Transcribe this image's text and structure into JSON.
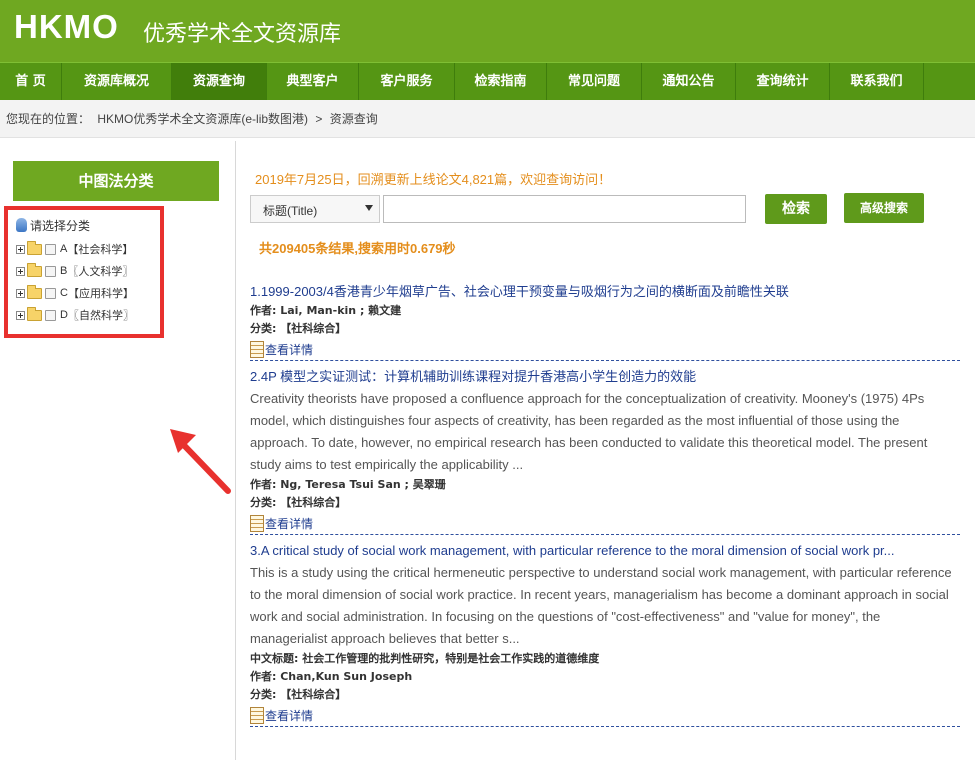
{
  "header": {
    "logo": "HKMO",
    "subtitle": "优秀学术全文资源库"
  },
  "nav": [
    {
      "label": "首 页",
      "width": 62
    },
    {
      "label": "资源库概况",
      "width": 110
    },
    {
      "label": "资源查询",
      "width": 95,
      "active": true
    },
    {
      "label": "典型客户",
      "width": 92
    },
    {
      "label": "客户服务",
      "width": 96
    },
    {
      "label": "检索指南",
      "width": 92
    },
    {
      "label": "常见问题",
      "width": 95
    },
    {
      "label": "通知公告",
      "width": 94
    },
    {
      "label": "查询统计",
      "width": 94
    },
    {
      "label": "联系我们",
      "width": 94
    }
  ],
  "breadcrumb": {
    "prefix": "您现在的位置：",
    "home": "HKMO优秀学术全文资源库(e-lib数图港)",
    "sep": ">",
    "current": "资源查询"
  },
  "sidebar": {
    "title": "中图法分类",
    "root": "请选择分类",
    "categories": [
      {
        "code": "A",
        "label": "【社会科学】"
      },
      {
        "code": "B",
        "label": "〖人文科学〗"
      },
      {
        "code": "C",
        "label": "【应用科学】"
      },
      {
        "code": "D",
        "label": "〖自然科学〗"
      }
    ]
  },
  "search": {
    "notice": "2019年7月25日，回溯更新上线论文4,821篇，欢迎查询访问！",
    "field_selected": "标题(Title)",
    "query": "",
    "search_label": "检索",
    "advanced_label": "高级搜索",
    "stats": "共209405条结果,搜索用时0.679秒"
  },
  "results": [
    {
      "title": "1.1999-2003/4香港青少年烟草广告、社会心理干预变量与吸烟行为之间的横断面及前瞻性关联",
      "abstract": "",
      "cn_title": "",
      "author": "作者: Lai, Man-kin ; 赖文建",
      "category": "分类: 【社科综合】",
      "detail": "查看详情"
    },
    {
      "title": "2.4P 模型之实证测试：计算机辅助训练课程对提升香港高小学生创造力的效能",
      "abstract": "Creativity theorists have proposed a confluence approach for the conceptualization of creativity. Mooney's (1975) 4Ps model, which distinguishes four aspects of creativity, has been regarded as the most influential of those using the approach. To date, however, no empirical research has been conducted to validate this theoretical model. The present study aims to test empirically the applicability ...",
      "cn_title": "",
      "author": "作者: Ng, Teresa Tsui San ; 吴翠珊",
      "category": "分类: 【社科综合】",
      "detail": "查看详情"
    },
    {
      "title": "3.A critical study of social work management, with particular reference to the moral dimension of social work pr...",
      "abstract": "This is a study using the critical hermeneutic perspective to understand social work management, with particular reference to the moral dimension of social work practice. In recent years, managerialism has become a dominant approach in social work and social administration. In focusing on the questions of \"cost-effectiveness\" and \"value for money\", the managerialist approach believes that better s...",
      "cn_title": "中文标题: 社会工作管理的批判性研究，特别是社会工作实践的道德维度",
      "author": "作者: Chan,Kun Sun Joseph",
      "category": "分类: 【社科综合】",
      "detail": "查看详情"
    }
  ]
}
